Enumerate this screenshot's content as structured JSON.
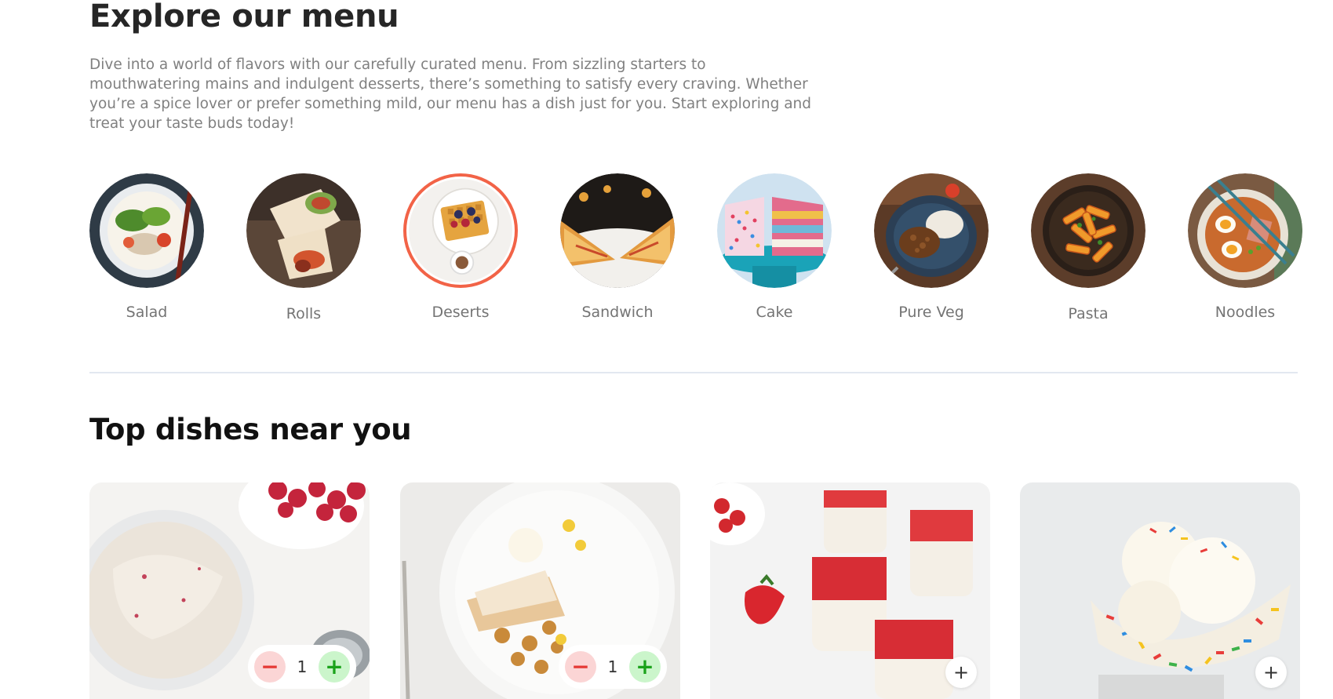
{
  "explore": {
    "title": "Explore our menu",
    "description": "Dive into a world of flavors with our carefully curated menu. From sizzling starters to mouthwatering mains and indulgent desserts, there’s something to satisfy every craving. Whether you’re a spice lover or prefer something mild, our menu has a dish just for you. Start exploring and treat your taste buds today!"
  },
  "menu": {
    "items": [
      {
        "label": "Salad",
        "active": false
      },
      {
        "label": "Rolls",
        "active": false
      },
      {
        "label": "Deserts",
        "active": true
      },
      {
        "label": "Sandwich",
        "active": false
      },
      {
        "label": "Cake",
        "active": false
      },
      {
        "label": "Pure Veg",
        "active": false
      },
      {
        "label": "Pasta",
        "active": false
      },
      {
        "label": "Noodles",
        "active": false
      }
    ],
    "active_color": "#f26347"
  },
  "top_dishes": {
    "title": "Top dishes near you",
    "cards": [
      {
        "counter": {
          "minus": "−",
          "value": "1",
          "plus": "+"
        }
      },
      {
        "counter": {
          "minus": "−",
          "value": "1",
          "plus": "+"
        }
      },
      {
        "add": "+"
      },
      {
        "add": "+"
      }
    ]
  }
}
